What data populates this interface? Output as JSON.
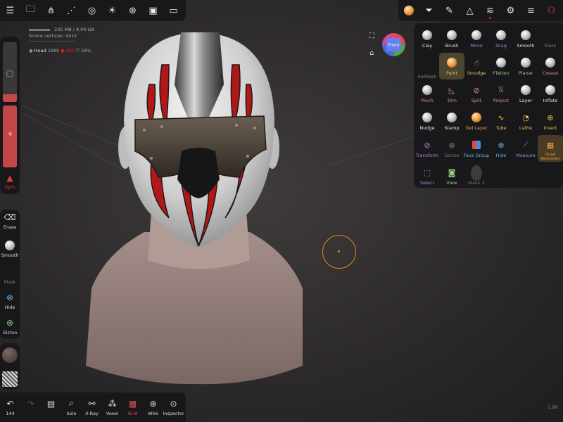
{
  "scene": {
    "memory": "235 MB / 8.00 GB",
    "vertices": "Scene vertices: 441k",
    "mesh_name": "Head",
    "count_a": "189k",
    "count_b": "86k",
    "count_c": "18%"
  },
  "top_left_icons": [
    "hamburger-icon",
    "folder-icon",
    "share-icon",
    "scene-tree-icon",
    "material-icon",
    "light-icon",
    "settings-wheel-icon",
    "image-icon",
    "video-icon"
  ],
  "top_right_icons": [
    "matcap-icon",
    "filter-icon",
    "eyedropper-icon",
    "symmetry-icon",
    "layers-icon",
    "gear-icon",
    "sliders-icon",
    "vr-icon"
  ],
  "view": {
    "front_label": "Front"
  },
  "tools": [
    {
      "label": "Clay",
      "color": "#e8e8e8"
    },
    {
      "label": "Brush",
      "color": "#e8e8e8"
    },
    {
      "label": "Move",
      "color": "#7f9bd8"
    },
    {
      "label": "Drag",
      "color": "#7f9bd8"
    },
    {
      "label": "Smooth",
      "color": "#e8e8e8"
    },
    {
      "label": "Mask",
      "color": "#7c7c7c"
    },
    {
      "label": "SelMask",
      "color": "#7c7c7c"
    },
    {
      "label": "Paint",
      "color": "#e8c24a"
    },
    {
      "label": "Smudge",
      "color": "#e8c24a"
    },
    {
      "label": "Flatten",
      "color": "#8fd080"
    },
    {
      "label": "Planar",
      "color": "#8fd080"
    },
    {
      "label": "Crease",
      "color": "#d98aa8"
    },
    {
      "label": "Pinch",
      "color": "#d98aa8"
    },
    {
      "label": "Trim",
      "color": "#d98aa8"
    },
    {
      "label": "Split",
      "color": "#d98aa8"
    },
    {
      "label": "Project",
      "color": "#d98aa8"
    },
    {
      "label": "Layer",
      "color": "#e8e8e8"
    },
    {
      "label": "Inflate",
      "color": "#e8e8e8"
    },
    {
      "label": "Nudge",
      "color": "#e8e8e8"
    },
    {
      "label": "Stamp",
      "color": "#e8e8e8"
    },
    {
      "label": "Del.Layer",
      "color": "#e8a24a"
    },
    {
      "label": "Tube",
      "color": "#e8c24a"
    },
    {
      "label": "Lathe",
      "color": "#e8c24a"
    },
    {
      "label": "Insert",
      "color": "#e8c24a"
    },
    {
      "label": "Transform",
      "color": "#c07cd8"
    },
    {
      "label": "Gizmo",
      "color": "#7c7c7c"
    },
    {
      "label": "Face Group",
      "color": "#5cc8d0"
    },
    {
      "label": "Hide",
      "color": "#60b0e8"
    },
    {
      "label": "Measure",
      "color": "#7f9bd8"
    },
    {
      "label": "Quad Remesher",
      "color": "#e8a24a"
    },
    {
      "label": "Select",
      "color": "#7f9bd8"
    },
    {
      "label": "View",
      "color": "#8fd080"
    },
    {
      "label": "Mask 1",
      "color": "#7c7c7c"
    }
  ],
  "left_tools": {
    "sym": "Sym",
    "erase": "Erase",
    "smooth": "Smooth",
    "mask": "Mask",
    "hide": "Hide",
    "gizmo": "Gizmo"
  },
  "bottom": {
    "undo_count": "144",
    "solo": "Solo",
    "xray": "X-Ray",
    "voxel": "Voxel",
    "grid": "Grid",
    "wire": "Wire",
    "inspector": "Inspector"
  },
  "version": "1.90"
}
